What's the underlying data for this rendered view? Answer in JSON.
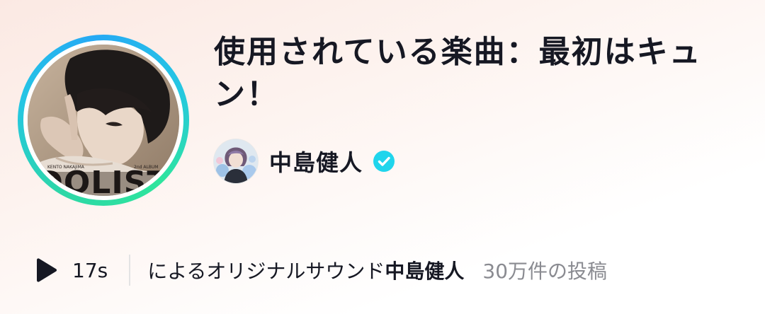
{
  "sound": {
    "title": "使用されている楽曲：最初はキュン！",
    "duration": "17s",
    "original_sound_prefix": "によるオリジナルサウンド",
    "original_sound_author": "中島健人",
    "post_count": "30万件の投稿"
  },
  "cover": {
    "album_text": "IDOLIST",
    "small_text_left": "KENTO NAKAJIMA",
    "small_text_right": "2nd ALBUM"
  },
  "author": {
    "name": "中島健人",
    "verified": true
  },
  "colors": {
    "ring_teal": "#2dd7a7",
    "ring_blue": "#26a9f4",
    "verified_blue": "#20d5ec",
    "secondary_text": "#8a8b91"
  },
  "icons": {
    "play": "play-icon",
    "verified": "verified-badge-icon"
  }
}
